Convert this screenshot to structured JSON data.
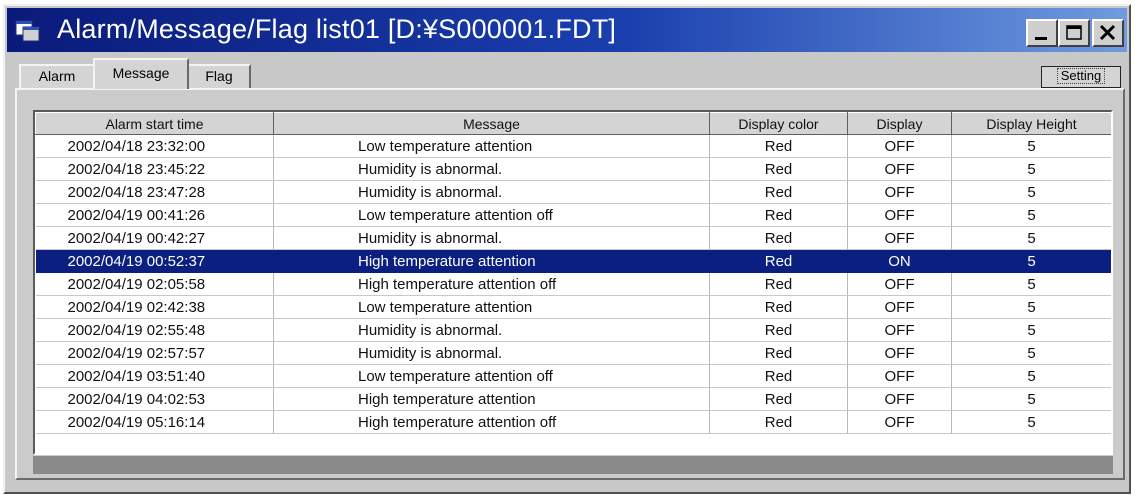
{
  "window": {
    "title": "Alarm/Message/Flag list01 [D:¥S000001.FDT]",
    "icon": "app-window-icon",
    "controls": [
      "minimize-icon",
      "maximize-icon",
      "close-icon"
    ]
  },
  "tabs": [
    {
      "label": "Alarm"
    },
    {
      "label": "Message"
    },
    {
      "label": "Flag"
    }
  ],
  "active_tab": "Message",
  "setting_button": "Setting",
  "table": {
    "headers": [
      "Alarm start time",
      "Message",
      "Display color",
      "Display",
      "Display Height"
    ],
    "rows": [
      {
        "time": "2002/04/18 23:32:00",
        "message": "Low temperature attention",
        "color": "Red",
        "display": "OFF",
        "height": "5"
      },
      {
        "time": "2002/04/18 23:45:22",
        "message": " Humidity is abnormal.",
        "color": "Red",
        "display": "OFF",
        "height": "5"
      },
      {
        "time": "2002/04/18 23:47:28",
        "message": " Humidity is abnormal.",
        "color": "Red",
        "display": "OFF",
        "height": "5"
      },
      {
        "time": "2002/04/19 00:41:26",
        "message": "Low temperature attention off",
        "color": "Red",
        "display": "OFF",
        "height": "5"
      },
      {
        "time": "2002/04/19 00:42:27",
        "message": " Humidity is abnormal.",
        "color": "Red",
        "display": "OFF",
        "height": "5"
      },
      {
        "time": "2002/04/19 00:52:37",
        "message": " High temperature attention",
        "color": "Red",
        "display": "ON",
        "height": "5"
      },
      {
        "time": "2002/04/19 02:05:58",
        "message": " High temperature attention off",
        "color": "Red",
        "display": "OFF",
        "height": "5"
      },
      {
        "time": "2002/04/19 02:42:38",
        "message": "Low temperature attention",
        "color": "Red",
        "display": "OFF",
        "height": "5"
      },
      {
        "time": "2002/04/19 02:55:48",
        "message": " Humidity is abnormal.",
        "color": "Red",
        "display": "OFF",
        "height": "5"
      },
      {
        "time": "2002/04/19 02:57:57",
        "message": " Humidity is abnormal.",
        "color": "Red",
        "display": "OFF",
        "height": "5"
      },
      {
        "time": "2002/04/19 03:51:40",
        "message": "Low temperature attention off",
        "color": "Red",
        "display": "OFF",
        "height": "5"
      },
      {
        "time": "2002/04/19 04:02:53",
        "message": " High temperature attention",
        "color": "Red",
        "display": "OFF",
        "height": "5"
      },
      {
        "time": "2002/04/19 05:16:14",
        "message": " High temperature attention off",
        "color": "Red",
        "display": "OFF",
        "height": "5"
      }
    ],
    "selected_row": 5
  },
  "colors": {
    "title_start": "#0a1a7a",
    "title_end": "#6f9be0",
    "selection": "#0a1f80",
    "chrome": "#d4d4d4"
  }
}
